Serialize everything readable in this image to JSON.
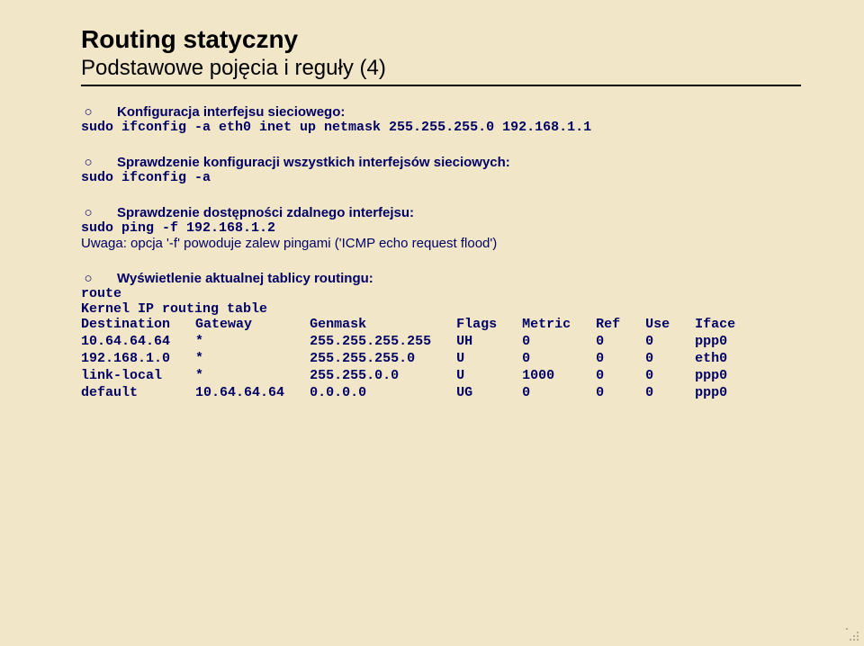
{
  "title": "Routing statyczny",
  "subtitle": "Podstawowe pojęcia i reguły (4)",
  "s1": {
    "heading": "Konfiguracja interfejsu sieciowego:",
    "cmd": "sudo ifconfig -a eth0 inet up netmask 255.255.255.0 192.168.1.1"
  },
  "s2": {
    "heading": "Sprawdzenie konfiguracji wszystkich interfejsów sieciowych:",
    "cmd": "sudo ifconfig -a"
  },
  "s3": {
    "heading": "Sprawdzenie dostępności zdalnego interfejsu:",
    "cmd": "sudo ping -f 192.168.1.2",
    "note": "Uwaga: opcja '-f' powoduje zalew pingami ('ICMP echo request flood')"
  },
  "s4": {
    "heading": "Wyświetlenie aktualnej tablicy routingu:",
    "cmd": "route",
    "caption": "Kernel IP routing table",
    "head": {
      "c1": "Destination",
      "c2": "Gateway",
      "c3": "Genmask",
      "c4": "Flags",
      "c5": "Metric",
      "c6": "Ref",
      "c7": "Use",
      "c8": "Iface"
    },
    "rows": [
      {
        "c1": "10.64.64.64",
        "c2": "*",
        "c3": "255.255.255.255",
        "c4": "UH",
        "c5": "0",
        "c6": "0",
        "c7": "0",
        "c8": "ppp0"
      },
      {
        "c1": "192.168.1.0",
        "c2": "*",
        "c3": "255.255.255.0",
        "c4": "U",
        "c5": "0",
        "c6": "0",
        "c7": "0",
        "c8": "eth0"
      },
      {
        "c1": "link-local",
        "c2": "*",
        "c3": "255.255.0.0",
        "c4": "U",
        "c5": "1000",
        "c6": "0",
        "c7": "0",
        "c8": "ppp0"
      },
      {
        "c1": "default",
        "c2": "10.64.64.64",
        "c3": "0.0.0.0",
        "c4": "UG",
        "c5": "0",
        "c6": "0",
        "c7": "0",
        "c8": "ppp0"
      }
    ]
  },
  "bullet_glyph": "○"
}
